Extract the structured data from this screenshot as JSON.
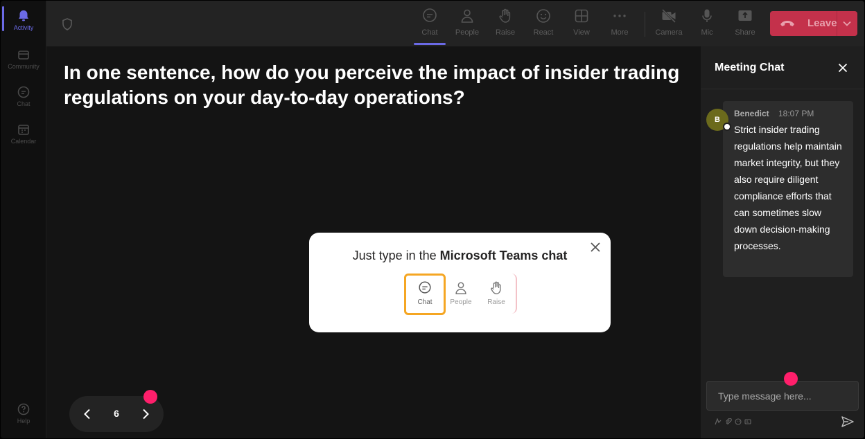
{
  "rail": {
    "items": [
      {
        "label": "Activity",
        "icon": "bell-icon"
      },
      {
        "label": "Community",
        "icon": "community-icon"
      },
      {
        "label": "Chat",
        "icon": "chat-icon"
      },
      {
        "label": "Calendar",
        "icon": "calendar-icon"
      },
      {
        "label": "Help",
        "icon": "help-icon"
      }
    ]
  },
  "toolbar": {
    "buttons": [
      {
        "label": "Chat",
        "icon": "chat-icon"
      },
      {
        "label": "People",
        "icon": "people-icon"
      },
      {
        "label": "Raise",
        "icon": "raise-hand-icon"
      },
      {
        "label": "React",
        "icon": "smiley-icon"
      },
      {
        "label": "View",
        "icon": "grid-icon"
      },
      {
        "label": "More",
        "icon": "more-icon"
      },
      {
        "label": "Camera",
        "icon": "camera-off-icon"
      },
      {
        "label": "Mic",
        "icon": "mic-icon"
      },
      {
        "label": "Share",
        "icon": "share-icon"
      }
    ],
    "leave_label": "Leave"
  },
  "main": {
    "question": "In one sentence, how do you perceive the impact of insider trading regulations on your day-to-day operations?"
  },
  "tip": {
    "prefix": "Just type in the ",
    "bold": "Microsoft Teams chat",
    "items": [
      {
        "label": "Chat"
      },
      {
        "label": "People"
      },
      {
        "label": "Raise"
      }
    ]
  },
  "pager": {
    "page": "6"
  },
  "chat": {
    "title": "Meeting Chat",
    "messages": [
      {
        "initial": "B",
        "author": "Benedict",
        "time": "18:07 PM",
        "text": "Strict insider trading regulations help maintain market integrity, but they also require diligent compliance efforts that can sometimes slow down decision-making processes."
      }
    ],
    "input_placeholder": "Type message here..."
  },
  "colors": {
    "accent": "#6b6ae6",
    "leave": "#c4314b",
    "highlight": "#f5a623",
    "pointer_dot": "#ff1f6b",
    "avatar": "#6b6a1c"
  }
}
